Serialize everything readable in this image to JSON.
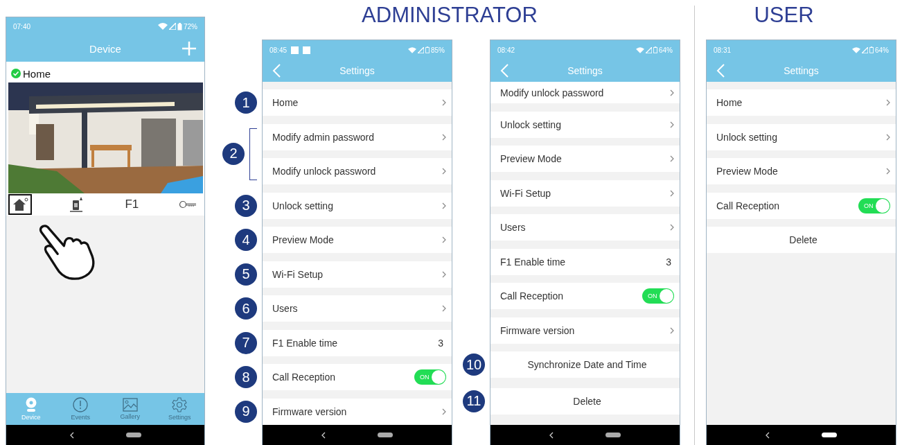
{
  "device_screen": {
    "time": "07:40",
    "battery": "72%",
    "title": "Device",
    "device": {
      "name": "Home",
      "online": true
    },
    "controls": [
      {
        "kind": "home",
        "selected": true
      },
      {
        "kind": "doorbell",
        "selected": false
      },
      {
        "kind": "text",
        "label": "F1",
        "selected": false
      },
      {
        "kind": "key",
        "selected": false
      }
    ],
    "nav": [
      {
        "kind": "camera",
        "label": "Device",
        "selected": true
      },
      {
        "kind": "events",
        "label": "Events",
        "selected": false
      },
      {
        "kind": "gallery",
        "label": "Gallery",
        "selected": false
      },
      {
        "kind": "settings",
        "label": "Settings",
        "selected": false
      }
    ]
  },
  "sections": [
    {
      "heading": "ADMINISTRATOR",
      "screens": [
        {
          "time": "08:45",
          "notifications": true,
          "battery": "85%",
          "title": "Settings",
          "scrolled": false,
          "groups": [
            {
              "badge": "1",
              "rows": [
                {
                  "kind": "link",
                  "label": "Home"
                }
              ]
            },
            {
              "badge": "2",
              "rows": [
                {
                  "kind": "link",
                  "label": "Modify admin password"
                },
                {
                  "kind": "link",
                  "label": "Modify unlock password"
                }
              ]
            },
            {
              "badge": "3",
              "rows": [
                {
                  "kind": "link",
                  "label": "Unlock setting"
                }
              ]
            },
            {
              "badge": "4",
              "rows": [
                {
                  "kind": "link",
                  "label": "Preview Mode"
                }
              ]
            },
            {
              "badge": "5",
              "rows": [
                {
                  "kind": "link",
                  "label": "Wi-Fi Setup"
                }
              ]
            },
            {
              "badge": "6",
              "rows": [
                {
                  "kind": "link",
                  "label": "Users"
                }
              ]
            },
            {
              "badge": "7",
              "rows": [
                {
                  "kind": "value",
                  "label": "F1 Enable time",
                  "value": "3"
                }
              ]
            },
            {
              "badge": "8",
              "rows": [
                {
                  "kind": "toggle",
                  "label": "Call Reception",
                  "on": true,
                  "toggle_text": "ON"
                }
              ]
            },
            {
              "badge": "9",
              "rows": [
                {
                  "kind": "link",
                  "label": "Firmware version"
                }
              ]
            }
          ]
        },
        {
          "time": "08:42",
          "battery": "64%",
          "title": "Settings",
          "scrolled": true,
          "groups": [
            {
              "rows": [
                {
                  "kind": "link",
                  "label": "Modify unlock password"
                }
              ]
            },
            {
              "rows": [
                {
                  "kind": "link",
                  "label": "Unlock setting"
                }
              ]
            },
            {
              "rows": [
                {
                  "kind": "link",
                  "label": "Preview Mode"
                }
              ]
            },
            {
              "rows": [
                {
                  "kind": "link",
                  "label": "Wi-Fi Setup"
                }
              ]
            },
            {
              "rows": [
                {
                  "kind": "link",
                  "label": "Users"
                }
              ]
            },
            {
              "rows": [
                {
                  "kind": "value",
                  "label": "F1 Enable time",
                  "value": "3"
                }
              ]
            },
            {
              "rows": [
                {
                  "kind": "toggle",
                  "label": "Call Reception",
                  "on": true,
                  "toggle_text": "ON"
                }
              ]
            },
            {
              "rows": [
                {
                  "kind": "link",
                  "label": "Firmware version"
                }
              ]
            },
            {
              "badge": "10",
              "rows": [
                {
                  "kind": "action",
                  "label": "Synchronize Date and Time"
                }
              ]
            },
            {
              "badge": "11",
              "rows": [
                {
                  "kind": "action",
                  "label": "Delete"
                }
              ]
            }
          ]
        }
      ]
    },
    {
      "heading": "USER",
      "screens": [
        {
          "time": "08:31",
          "battery": "64%",
          "title": "Settings",
          "scrolled": false,
          "groups": [
            {
              "rows": [
                {
                  "kind": "link",
                  "label": "Home"
                }
              ]
            },
            {
              "rows": [
                {
                  "kind": "link",
                  "label": "Unlock setting"
                }
              ]
            },
            {
              "rows": [
                {
                  "kind": "link",
                  "label": "Preview Mode"
                }
              ]
            },
            {
              "rows": [
                {
                  "kind": "toggle",
                  "label": "Call Reception",
                  "on": true,
                  "toggle_text": "ON"
                }
              ]
            },
            {
              "rows": [
                {
                  "kind": "action",
                  "label": "Delete"
                }
              ]
            }
          ]
        }
      ]
    }
  ]
}
